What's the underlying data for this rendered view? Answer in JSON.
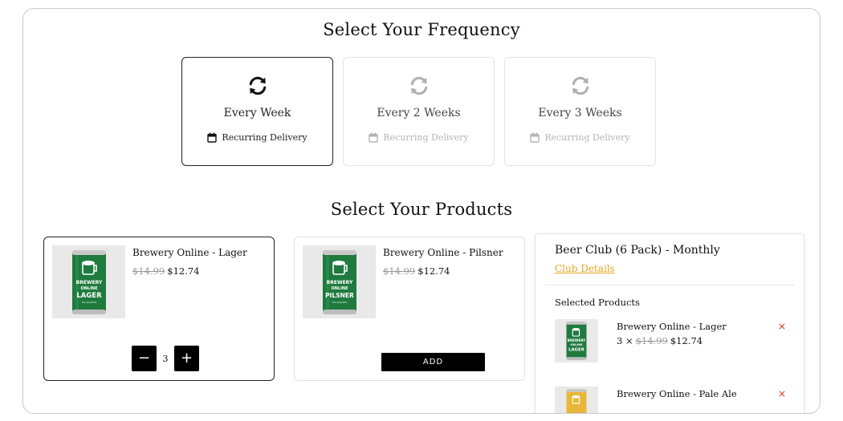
{
  "frequency": {
    "heading": "Select Your Frequency",
    "options": [
      {
        "label": "Every Week",
        "sub": "Recurring Delivery",
        "active": true
      },
      {
        "label": "Every 2 Weeks",
        "sub": "Recurring Delivery",
        "active": false
      },
      {
        "label": "Every 3 Weeks",
        "sub": "Recurring Delivery",
        "active": false
      }
    ]
  },
  "products": {
    "heading": "Select Your Products",
    "items": [
      {
        "name": "Brewery Online - Lager",
        "old_price": "$14.99",
        "price": "$12.74",
        "quantity": "3",
        "can_label": "LAGER",
        "can_brand_1": "BREWERY",
        "can_brand_2": "ONLINE",
        "can_small": "5% ALC/VOL"
      },
      {
        "name": "Brewery Online - Pilsner",
        "old_price": "$14.99",
        "price": "$12.74",
        "add_label": "ADD",
        "can_label": "PILSNER",
        "can_brand_1": "BREWERY",
        "can_brand_2": "ONLINE",
        "can_small": "5% ALC/VOL"
      }
    ],
    "minus_symbol": "−",
    "plus_symbol": "+"
  },
  "club": {
    "title": "Beer Club (6 Pack) - Monthly",
    "details_link": "Club Details",
    "selected_heading": "Selected Products",
    "selected": [
      {
        "name": "Brewery Online - Lager",
        "qty_prefix": "3 ×",
        "old_price": "$14.99",
        "price": "$12.74",
        "remove": "×",
        "can_label": "LAGER",
        "can_brand_1": "BREWERY",
        "can_brand_2": "ONLINE"
      },
      {
        "name": "Brewery Online - Pale Ale",
        "remove": "×"
      }
    ]
  },
  "colors": {
    "accent_link": "#e6a520",
    "remove": "#e0332b",
    "can_green": "#1f7a3e",
    "can_yellow": "#e8b73a",
    "button_bg": "#000000"
  },
  "icons": {
    "frequency": "refresh-icon",
    "recurring": "calendar-icon"
  }
}
